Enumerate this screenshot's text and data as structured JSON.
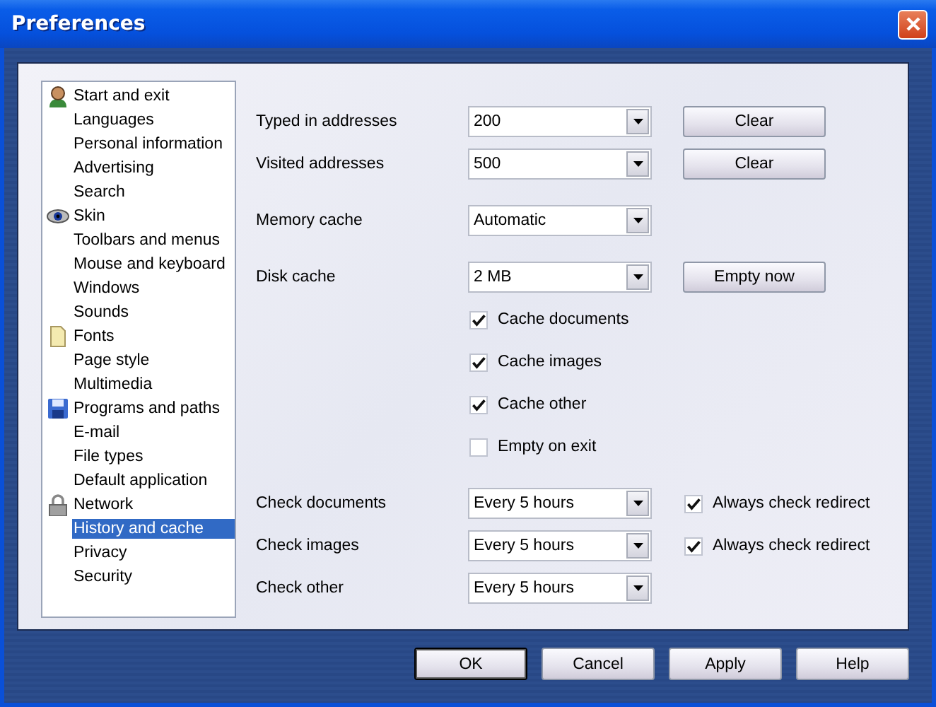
{
  "window": {
    "title": "Preferences"
  },
  "sidebar": {
    "items": [
      {
        "label": "Start and exit",
        "selected": false,
        "kind": "person"
      },
      {
        "label": "Languages",
        "selected": false
      },
      {
        "label": "Personal information",
        "selected": false
      },
      {
        "label": "Advertising",
        "selected": false
      },
      {
        "label": "Search",
        "selected": false
      },
      {
        "label": "Skin",
        "selected": false,
        "kind": "eye"
      },
      {
        "label": "Toolbars and menus",
        "selected": false
      },
      {
        "label": "Mouse and keyboard",
        "selected": false
      },
      {
        "label": "Windows",
        "selected": false
      },
      {
        "label": "Sounds",
        "selected": false
      },
      {
        "label": "Fonts",
        "selected": false,
        "kind": "page"
      },
      {
        "label": "Page style",
        "selected": false
      },
      {
        "label": "Multimedia",
        "selected": false
      },
      {
        "label": "Programs and paths",
        "selected": false,
        "kind": "disk"
      },
      {
        "label": "E-mail",
        "selected": false
      },
      {
        "label": "File types",
        "selected": false
      },
      {
        "label": "Default application",
        "selected": false
      },
      {
        "label": "Network",
        "selected": false,
        "kind": "lock"
      },
      {
        "label": "History and cache",
        "selected": true
      },
      {
        "label": "Privacy",
        "selected": false
      },
      {
        "label": "Security",
        "selected": false
      }
    ]
  },
  "groups": [
    [
      {
        "kind": "select",
        "label": "Typed in addresses",
        "value": "200",
        "button": "Clear"
      },
      {
        "kind": "select",
        "label": "Visited addresses",
        "value": "500",
        "button": "Clear"
      }
    ],
    [
      {
        "kind": "select",
        "label": "Memory cache",
        "value": "Automatic"
      }
    ],
    [
      {
        "kind": "select",
        "label": "Disk cache",
        "value": "2 MB",
        "button": "Empty now"
      },
      {
        "kind": "checkbox",
        "label": "Cache documents",
        "checked": true
      },
      {
        "kind": "checkbox",
        "label": "Cache images",
        "checked": true
      },
      {
        "kind": "checkbox",
        "label": "Cache other",
        "checked": true
      },
      {
        "kind": "checkbox",
        "label": "Empty on exit",
        "checked": false
      }
    ],
    [
      {
        "kind": "select",
        "label": "Check documents",
        "value": "Every 5 hours",
        "option": {
          "label": "Always check redirect",
          "checked": true
        }
      },
      {
        "kind": "select",
        "label": "Check images",
        "value": "Every 5 hours",
        "option": {
          "label": "Always check redirect",
          "checked": true
        }
      },
      {
        "kind": "select",
        "label": "Check other",
        "value": "Every 5 hours"
      }
    ]
  ],
  "buttons": [
    {
      "label": "OK",
      "default": true
    },
    {
      "label": "Cancel",
      "default": false
    },
    {
      "label": "Apply",
      "default": false
    },
    {
      "label": "Help",
      "default": false
    }
  ]
}
